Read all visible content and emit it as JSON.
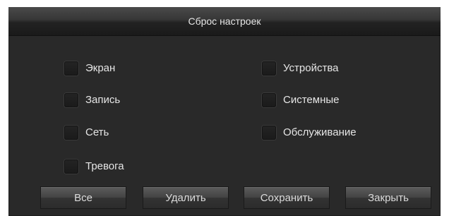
{
  "dialog": {
    "title": "Сброс настроек"
  },
  "options": {
    "screen": {
      "label": "Экран",
      "checked": false
    },
    "record": {
      "label": "Запись",
      "checked": false
    },
    "network": {
      "label": "Сеть",
      "checked": false
    },
    "alarm": {
      "label": "Тревога",
      "checked": false
    },
    "devices": {
      "label": "Устройства",
      "checked": false
    },
    "system": {
      "label": "Системные",
      "checked": false
    },
    "maintenance": {
      "label": "Обслуживание",
      "checked": false
    }
  },
  "buttons": {
    "all": "Все",
    "delete": "Удалить",
    "save": "Сохранить",
    "close": "Закрыть"
  },
  "colors": {
    "dialog_background": "#292929",
    "text": "#e6e6e6",
    "checkbox": "#1f1f1f"
  }
}
